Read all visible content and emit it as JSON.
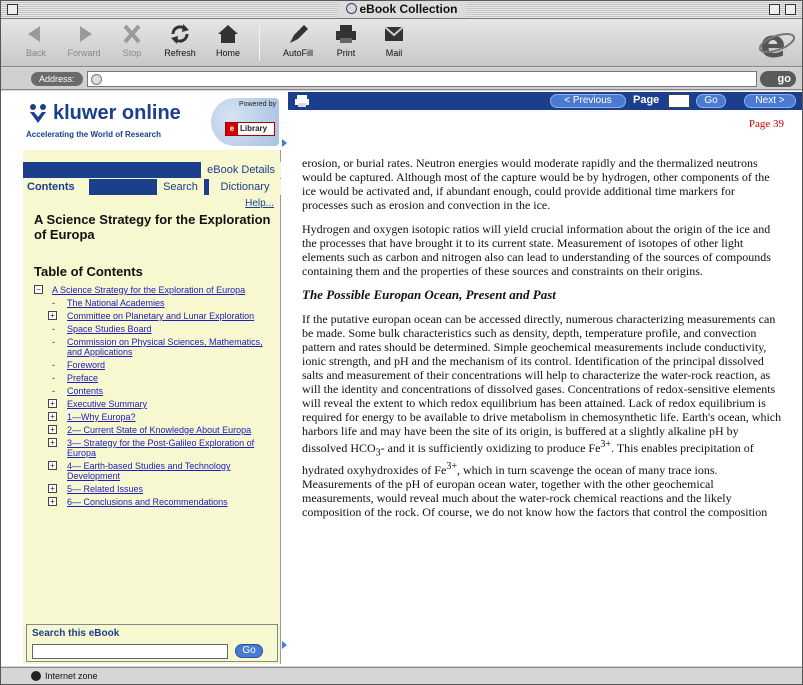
{
  "window": {
    "title": "eBook Collection"
  },
  "toolbar": {
    "back": "Back",
    "forward": "Forward",
    "stop": "Stop",
    "refresh": "Refresh",
    "home": "Home",
    "autofill": "AutoFill",
    "print": "Print",
    "mail": "Mail"
  },
  "address": {
    "label": "Address:",
    "value": "",
    "go": "go"
  },
  "brand": {
    "name": "kluwer online",
    "tagline": "Accelerating the World of Research",
    "powered_by": "Powered by",
    "library": "Library"
  },
  "tabs": {
    "ebook_details": "eBook Details",
    "contents": "Contents",
    "search": "Search",
    "dictionary": "Dictionary",
    "help": "Help..."
  },
  "book": {
    "title": "A Science Strategy for the Exploration of Europa"
  },
  "toc": {
    "title": "Table of Contents",
    "items": [
      {
        "label": "A Science Strategy for the Exploration of Europa",
        "marker": "minus",
        "level": 0
      },
      {
        "label": "The National Academies",
        "marker": "dash",
        "level": 1
      },
      {
        "label": "Committee on Planetary and Lunar Exploration",
        "marker": "plus",
        "level": 1
      },
      {
        "label": "Space Studies Board",
        "marker": "dash",
        "level": 1
      },
      {
        "label": "Commission on Physical Sciences, Mathematics, and Applications",
        "marker": "dash",
        "level": 1
      },
      {
        "label": "Foreword",
        "marker": "dash",
        "level": 1
      },
      {
        "label": "Preface",
        "marker": "dash",
        "level": 1
      },
      {
        "label": "Contents",
        "marker": "dash",
        "level": 1
      },
      {
        "label": "Executive Summary",
        "marker": "plus",
        "level": 1
      },
      {
        "label": "1—Why Europa?",
        "marker": "plus",
        "level": 1
      },
      {
        "label": "2— Current State of Knowledge About Europa",
        "marker": "plus",
        "level": 1
      },
      {
        "label": "3— Strategy for the Post-Galileo Exploration of Europa",
        "marker": "plus",
        "level": 1
      },
      {
        "label": "4— Earth-based Studies and Technology Development",
        "marker": "plus",
        "level": 1
      },
      {
        "label": "5— Related Issues",
        "marker": "plus",
        "level": 1
      },
      {
        "label": "6— Conclusions and Recommendations",
        "marker": "plus",
        "level": 1
      }
    ]
  },
  "search_ebook": {
    "label": "Search this eBook",
    "placeholder": "",
    "go": "Go"
  },
  "nav": {
    "previous": "< Previous",
    "page_label": "Page",
    "go": "Go",
    "next": "Next >",
    "page_number": "Page 39"
  },
  "content": {
    "p1": "erosion, or burial rates. Neutron energies would moderate rapidly and the thermalized neutrons would be captured. Although most of the capture would be by hydrogen, other components of the ice would be activated and, if abundant enough, could provide additional time markers for processes such as erosion and convection in the ice.",
    "p2": "Hydrogen and oxygen isotopic ratios will yield crucial information about the origin of the ice and the processes that have brought it to its current state. Measurement of isotopes of other light elements such as carbon and nitrogen also can lead to understanding of the sources of compounds containing them and the properties of these sources and constraints on their origins.",
    "heading": "The Possible Europan Ocean, Present and Past",
    "p3a": "If the putative europan ocean can be accessed directly, numerous characterizing measurements can be made. Some bulk characteristics such as density, depth, temperature profile, and convection pattern and rates should be determined. Simple geochemical measurements include conductivity, ionic strength, and pH and the mechanism of its control. Identification of the principal dissolved salts and measurement of their concentrations will help to characterize the water-rock reaction, as will the identity and concentrations of dissolved gases. Concentrations of redox-sensitive elements will reveal the extent to which redox equilibrium has been attained. Lack of redox equilibrium is required for energy to be available to drive metabolism in chemosynthetic life. Earth's ocean, which harbors life and may have been the site of its origin, is buffered at a slightly alkaline pH by dissolved HCO",
    "p3_sub": "3",
    "p3b": "- and it is sufficiently oxidizing to produce Fe",
    "p3_sup1": "3+",
    "p3c": ". This enables precipitation of hydrated oxyhydroxides of Fe",
    "p3_sup2": "3+",
    "p3d": ", which in turn scavenge the ocean of many trace ions. Measurements of the pH of europan ocean water, together with the other geochemical measurements, would reveal much about the water-rock chemical reactions and the likely composition of the rock. Of course, we do not know how the factors that control the composition"
  },
  "status": {
    "zone": "Internet zone"
  },
  "colors": {
    "brand_blue": "#1b3f8c",
    "sidebar_bg": "#f7f7d0",
    "button_blue": "#4a7bd0",
    "page_red": "#cc0000"
  }
}
